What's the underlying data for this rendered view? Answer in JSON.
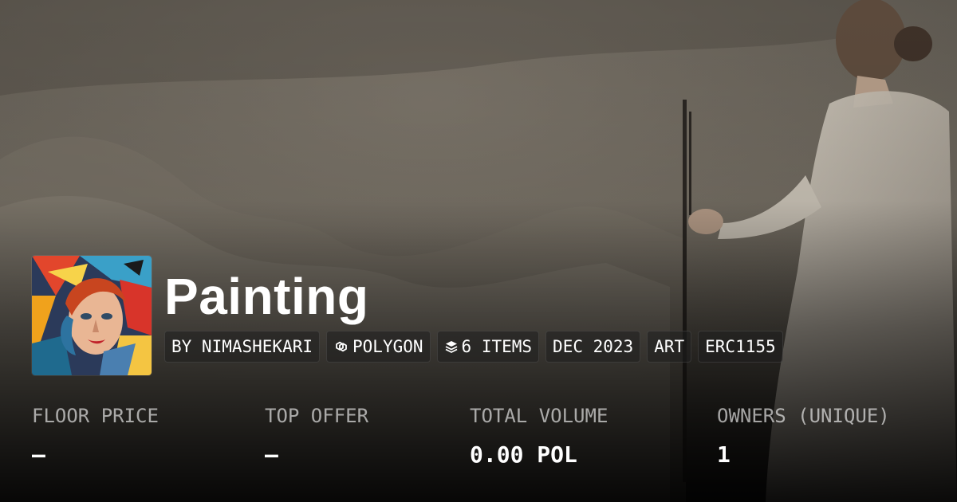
{
  "collection": {
    "title": "Painting"
  },
  "badges": [
    {
      "label": "BY NIMASHEKARI",
      "icon": ""
    },
    {
      "label": "POLYGON",
      "icon": "polygon-chain-icon"
    },
    {
      "label": "6 ITEMS",
      "icon": "layers-icon"
    },
    {
      "label": "DEC 2023",
      "icon": ""
    },
    {
      "label": "ART",
      "icon": ""
    },
    {
      "label": "ERC1155",
      "icon": ""
    }
  ],
  "stats": [
    {
      "label": "FLOOR PRICE",
      "value": "–"
    },
    {
      "label": "TOP OFFER",
      "value": "–"
    },
    {
      "label": "TOTAL VOLUME",
      "value": "0.00 POL"
    },
    {
      "label": "OWNERS (UNIQUE)",
      "value": "1"
    }
  ],
  "colors": {
    "text_primary": "#ffffff",
    "text_muted": "#9e9e9e",
    "badge_background": "#1e1e1e"
  }
}
